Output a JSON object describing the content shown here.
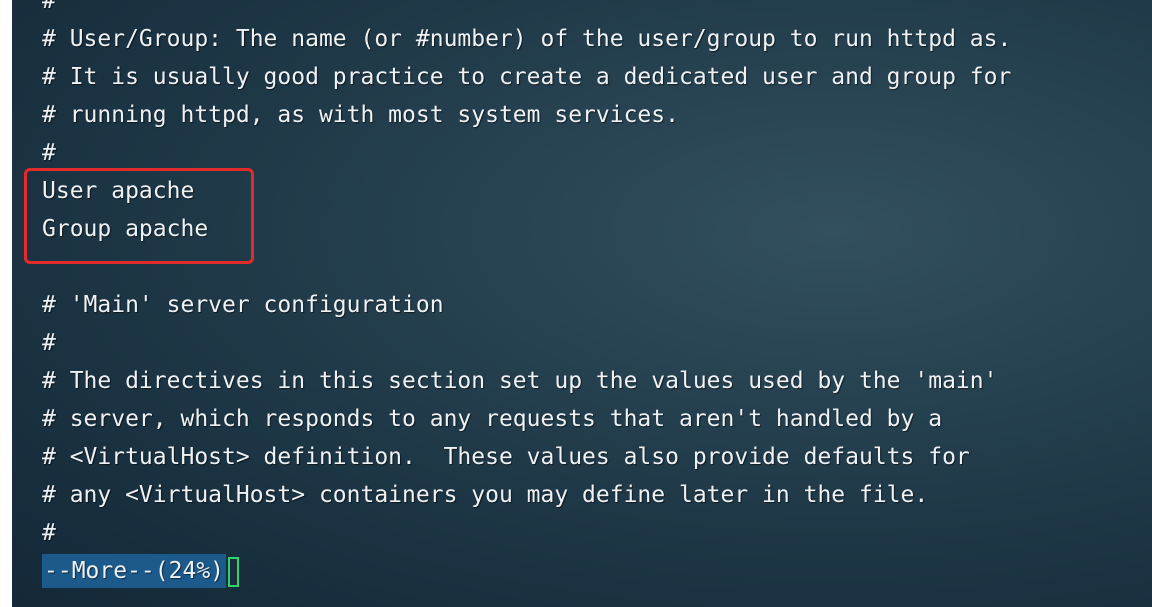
{
  "terminal": {
    "lines": [
      "#",
      "# User/Group: The name (or #number) of the user/group to run httpd as.",
      "# It is usually good practice to create a dedicated user and group for",
      "# running httpd, as with most system services.",
      "#",
      "User apache",
      "Group apache",
      "",
      "# 'Main' server configuration",
      "#",
      "# The directives in this section set up the values used by the 'main'",
      "# server, which responds to any requests that aren't handled by a",
      "# <VirtualHost> definition.  These values also provide defaults for",
      "# any <VirtualHost> containers you may define later in the file.",
      "#"
    ],
    "pager_prompt": "--More--(24%)",
    "highlight_color": "#e32b2b",
    "prompt_bg_color": "#1d5a8c",
    "cursor_color": "#2fd46a"
  }
}
